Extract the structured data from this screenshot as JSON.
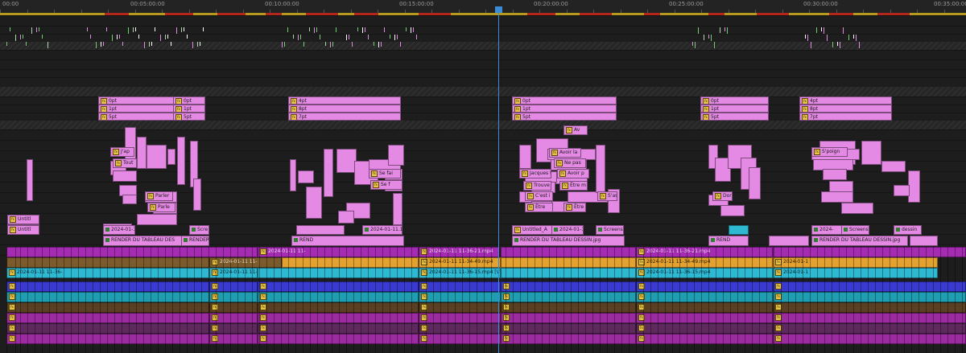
{
  "timeline": {
    "ruler_labels": [
      "00:00",
      "00:05:00:00",
      "00:10:00:00",
      "00:15:00:00",
      "00:20:00:00",
      "00:25:00:00",
      "00:30:00:00",
      "00:35:00:00"
    ],
    "playhead_label": "playhead"
  },
  "clips": {
    "untitled_1": "Untitl",
    "untitled_2": "Untitl",
    "pt_labels": [
      "0pt",
      "1pt",
      "5pt",
      "0pt",
      "1pt",
      "5pt",
      "4pt",
      "8pt",
      "7pt"
    ],
    "jap": "J'ap",
    "tout": "Tout",
    "parler": "Parler",
    "parle": "Parle",
    "sefai": "Se fai",
    "sef": "Se f",
    "av": "Av",
    "avoirla": "Avoir la",
    "nepas": "Ne pas",
    "avoirp": "Avoir p",
    "jacques": "Jacques t",
    "trouve": "Trouve",
    "etrem": "Être m",
    "cest": "C'est i",
    "sas": "S'as",
    "etre1": "Être",
    "etre2": "Être",
    "dor": "Dor",
    "spoign": "S'poign",
    "render_dessin": "RENDER DU TABLEAU DESSIN.jpg",
    "render_des": "RENDER DU TABLEAU DES",
    "render": "RENDER",
    "rend": "REND",
    "render_dessin_jpg": "RENDER DU TABLEAU DESSIN.jpg",
    "render_jpg2": "RENDER DU TABLEAU DESSIN.jpg",
    "date_a": "2024-01-11 11-",
    "date_b": "2024-01-11 11-36-",
    "date_c": "2024-01-11 11-34-49.mp4",
    "date_d": "2024-01-11 11-36-15.mp4 [V]",
    "date_e": "2024-01-11 11-34-49.mp4",
    "date_f": "2024-01-11 11-36-15.mp4",
    "date_g": "2024-01-11 11-36-21.mp4",
    "date_h": "2024-01-11 11-36-21.mp4",
    "date_i": "2024-01-1",
    "screen": "Scre",
    "screens": "Screens",
    "screensh": "Screensh",
    "untitled_a": "Untitled_A",
    "untitled_a2": "Untitled_A",
    "dessin": "dessin",
    "date_j": "2024-01-11.1",
    "date_k": "2024-",
    "date_l": "2024-01-1"
  },
  "colors": {
    "graphics_clip": "#e48ae4",
    "video_purple": "#a62bb3",
    "video_orange": "#e3a130",
    "video_cyan": "#2fb8d2",
    "audio_blue": "#3a3ad0",
    "playhead": "#3a8bd8",
    "render_bar": "#b59a1f"
  },
  "icons": [
    "fx-badge-icon",
    "green-square-icon",
    "marker-icon"
  ]
}
